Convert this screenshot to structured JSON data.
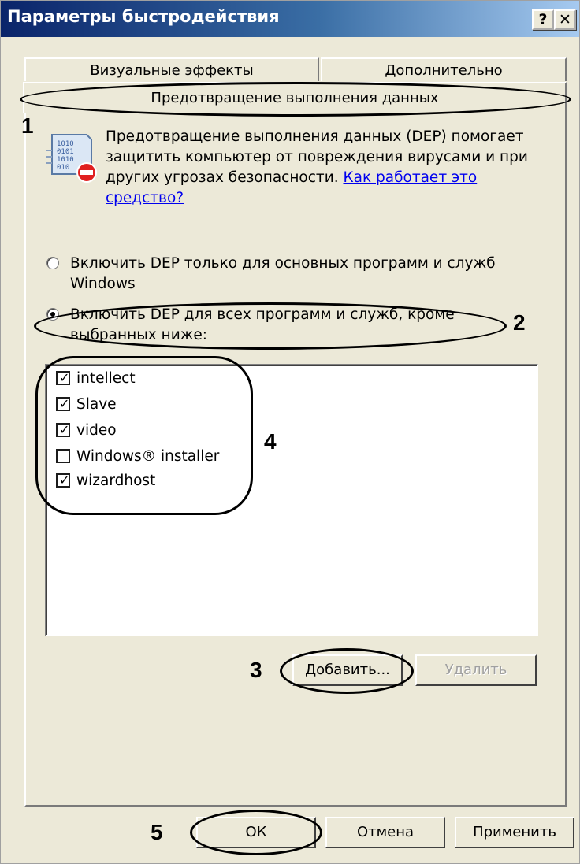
{
  "window": {
    "title": "Параметры быстродействия",
    "help_label": "?",
    "close_label": "✕"
  },
  "tabs": [
    {
      "label": "Визуальные эффекты"
    },
    {
      "label": "Дополнительно"
    },
    {
      "label": "Предотвращение выполнения данных"
    }
  ],
  "description": {
    "text": "Предотвращение выполнения данных (DEP) помогает защитить компьютер от повреждения вирусами и при других угрозах безопасности. ",
    "link": "Как работает это средство?"
  },
  "options": [
    {
      "label": "Включить DEP только для основных программ и служб Windows",
      "checked": false
    },
    {
      "label": "Включить DEP для всех программ и служб, кроме выбранных ниже:",
      "checked": true
    }
  ],
  "exceptions": [
    {
      "label": "intellect",
      "checked": true
    },
    {
      "label": "Slave",
      "checked": true
    },
    {
      "label": "video",
      "checked": true
    },
    {
      "label": "Windows® installer",
      "checked": false
    },
    {
      "label": "wizardhost",
      "checked": true
    }
  ],
  "buttons": {
    "add": "Добавить...",
    "remove": "Удалить",
    "ok": "ОК",
    "cancel": "Отмена",
    "apply": "Применить"
  },
  "callouts": [
    "1",
    "2",
    "3",
    "4",
    "5"
  ],
  "icons": {
    "dep_icon": "binary-document-icon",
    "check_mark": "✓"
  }
}
